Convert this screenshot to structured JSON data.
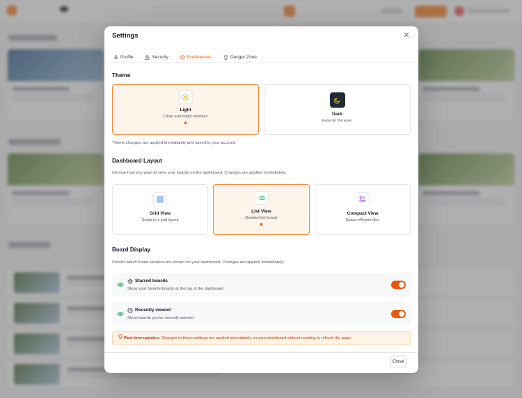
{
  "colors": {
    "accent": "#ea580c",
    "selected_bg": "#fff4ea",
    "notice_bg": "#fff3e6",
    "eye_green": "#16a34a"
  },
  "modal": {
    "title": "Settings",
    "close_icon": "close-icon",
    "tabs": [
      {
        "label": "Profile",
        "icon": "user-icon",
        "active": false
      },
      {
        "label": "Security",
        "icon": "lock-icon",
        "active": false
      },
      {
        "label": "Preferences",
        "icon": "palette-icon",
        "active": true
      },
      {
        "label": "Danger Zone",
        "icon": "trash-icon",
        "active": false
      }
    ],
    "theme": {
      "title": "Theme",
      "options": [
        {
          "name": "Light",
          "desc": "Clean and bright interface",
          "icon": "sun-icon",
          "selected": true
        },
        {
          "name": "Dark",
          "desc": "Easy on the eyes",
          "icon": "moon-icon",
          "selected": false
        }
      ],
      "note": "Theme changes are applied immediately and saved to your account."
    },
    "layout": {
      "title": "Dashboard Layout",
      "desc": "Choose how you want to view your boards on the dashboard. Changes are applied immediately.",
      "options": [
        {
          "name": "Grid View",
          "desc": "Cards in a grid layout",
          "icon": "grid-icon",
          "selected": false
        },
        {
          "name": "List View",
          "desc": "Detailed list format",
          "icon": "list-icon",
          "selected": true
        },
        {
          "name": "Compact View",
          "desc": "Space-efficient tiles",
          "icon": "compact-list-icon",
          "selected": false
        }
      ]
    },
    "board_display": {
      "title": "Board Display",
      "desc": "Control which board sections are shown on your dashboard. Changes are applied immediately.",
      "items": [
        {
          "name": "Starred boards",
          "desc": "Show your favorite boards at the top of the dashboard",
          "icon": "star-icon",
          "enabled": true
        },
        {
          "name": "Recently viewed",
          "desc": "Show boards you've recently opened",
          "icon": "clock-icon",
          "enabled": true
        }
      ]
    },
    "notice": {
      "bold": "Real-time updates:",
      "text": " Changes to these settings are applied immediately on your dashboard without needing to refresh the page."
    },
    "close_button": "Close"
  }
}
